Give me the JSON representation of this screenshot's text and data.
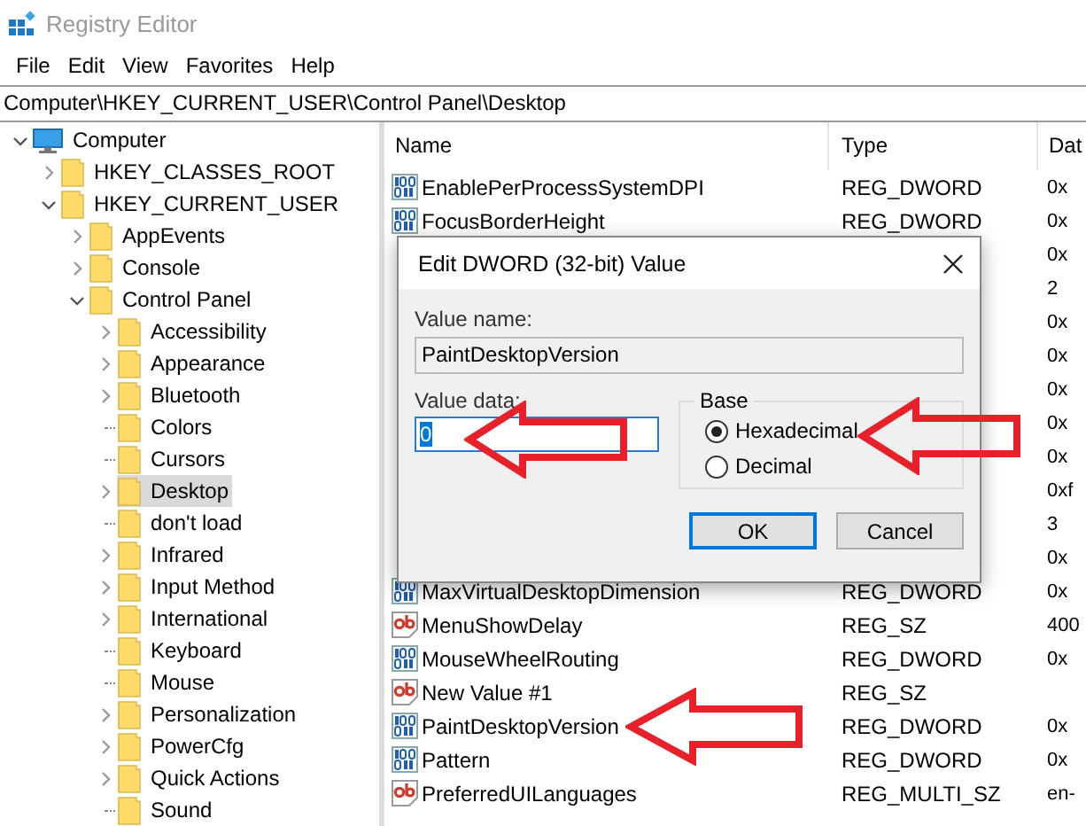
{
  "window": {
    "title": "Registry Editor"
  },
  "menu": [
    "File",
    "Edit",
    "View",
    "Favorites",
    "Help"
  ],
  "address": "Computer\\HKEY_CURRENT_USER\\Control Panel\\Desktop",
  "tree": [
    {
      "label": "Computer",
      "kind": "computer",
      "expandable": true,
      "expanded": true,
      "selected": false,
      "children": [
        {
          "label": "HKEY_CLASSES_ROOT",
          "kind": "folder",
          "expandable": true,
          "expanded": false,
          "selected": false
        },
        {
          "label": "HKEY_CURRENT_USER",
          "kind": "folder",
          "expandable": true,
          "expanded": true,
          "selected": false,
          "children": [
            {
              "label": "AppEvents",
              "kind": "folder",
              "expandable": true,
              "expanded": false,
              "selected": false
            },
            {
              "label": "Console",
              "kind": "folder",
              "expandable": true,
              "expanded": false,
              "selected": false
            },
            {
              "label": "Control Panel",
              "kind": "folder",
              "expandable": true,
              "expanded": true,
              "selected": false,
              "children": [
                {
                  "label": "Accessibility",
                  "kind": "folder",
                  "expandable": true,
                  "expanded": false,
                  "selected": false
                },
                {
                  "label": "Appearance",
                  "kind": "folder",
                  "expandable": true,
                  "expanded": false,
                  "selected": false
                },
                {
                  "label": "Bluetooth",
                  "kind": "folder",
                  "expandable": true,
                  "expanded": false,
                  "selected": false
                },
                {
                  "label": "Colors",
                  "kind": "folder",
                  "expandable": false,
                  "selected": false
                },
                {
                  "label": "Cursors",
                  "kind": "folder",
                  "expandable": false,
                  "selected": false
                },
                {
                  "label": "Desktop",
                  "kind": "folder",
                  "expandable": true,
                  "expanded": false,
                  "selected": true
                },
                {
                  "label": "don't load",
                  "kind": "folder",
                  "expandable": false,
                  "selected": false
                },
                {
                  "label": "Infrared",
                  "kind": "folder",
                  "expandable": true,
                  "expanded": false,
                  "selected": false
                },
                {
                  "label": "Input Method",
                  "kind": "folder",
                  "expandable": true,
                  "expanded": false,
                  "selected": false
                },
                {
                  "label": "International",
                  "kind": "folder",
                  "expandable": true,
                  "expanded": false,
                  "selected": false
                },
                {
                  "label": "Keyboard",
                  "kind": "folder",
                  "expandable": false,
                  "selected": false
                },
                {
                  "label": "Mouse",
                  "kind": "folder",
                  "expandable": false,
                  "selected": false
                },
                {
                  "label": "Personalization",
                  "kind": "folder",
                  "expandable": true,
                  "expanded": false,
                  "selected": false
                },
                {
                  "label": "PowerCfg",
                  "kind": "folder",
                  "expandable": true,
                  "expanded": false,
                  "selected": false
                },
                {
                  "label": "Quick Actions",
                  "kind": "folder",
                  "expandable": true,
                  "expanded": false,
                  "selected": false
                },
                {
                  "label": "Sound",
                  "kind": "folder",
                  "expandable": false,
                  "selected": false
                }
              ]
            }
          ]
        }
      ]
    }
  ],
  "list": {
    "columns": [
      "Name",
      "Type",
      "Dat"
    ],
    "rows": [
      {
        "kind": "dword",
        "name": "EnablePerProcessSystemDPI",
        "type": "REG_DWORD",
        "data": "0x"
      },
      {
        "kind": "dword",
        "name": "FocusBorderHeight",
        "type": "REG_DWORD",
        "data": "0x"
      },
      {
        "data": "0x"
      },
      {
        "data": "2"
      },
      {
        "data": "0x"
      },
      {
        "data": "0x"
      },
      {
        "data": "0x"
      },
      {
        "data": "0x"
      },
      {
        "data": "0x"
      },
      {
        "data": "0xf"
      },
      {
        "data": "3"
      },
      {
        "data": "0x"
      },
      {
        "kind": "dword",
        "name": "MaxVirtualDesktopDimension",
        "type": "REG_DWORD",
        "data": "0x"
      },
      {
        "kind": "string",
        "name": "MenuShowDelay",
        "type": "REG_SZ",
        "data": "400"
      },
      {
        "kind": "dword",
        "name": "MouseWheelRouting",
        "type": "REG_DWORD",
        "data": "0x"
      },
      {
        "kind": "string",
        "name": "New Value #1",
        "type": "REG_SZ"
      },
      {
        "kind": "dword",
        "name": "PaintDesktopVersion",
        "type": "REG_DWORD",
        "data": "0x"
      },
      {
        "kind": "dword",
        "name": "Pattern",
        "type": "REG_DWORD",
        "data": "0x"
      },
      {
        "kind": "string",
        "name": "PreferredUILanguages",
        "type": "REG_MULTI_SZ",
        "data": "en-"
      }
    ]
  },
  "dialog": {
    "title": "Edit DWORD (32-bit) Value",
    "value_name_label": "Value name:",
    "value_name": "PaintDesktopVersion",
    "value_data_label": "Value data:",
    "value_data": "0",
    "base_label": "Base",
    "base_options": [
      {
        "label": "Hexadecimal",
        "selected": true
      },
      {
        "label": "Decimal",
        "selected": false
      }
    ],
    "buttons": [
      {
        "label": "OK",
        "default": true
      },
      {
        "label": "Cancel",
        "default": false
      }
    ]
  }
}
